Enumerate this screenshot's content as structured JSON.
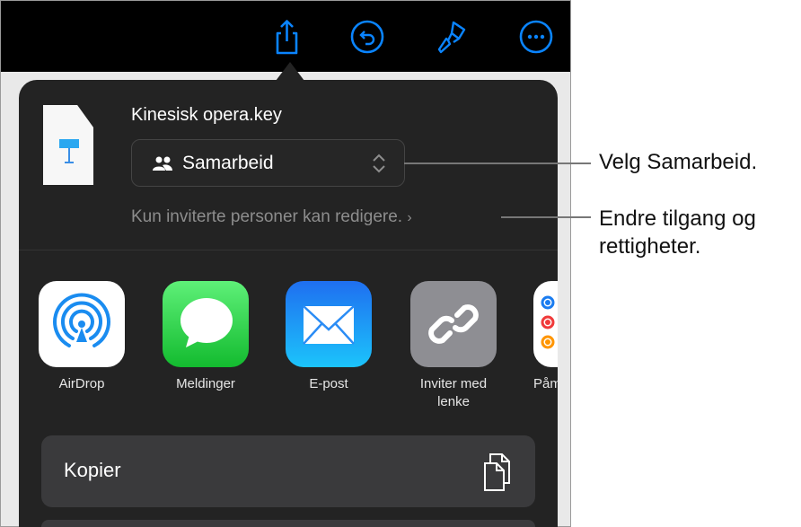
{
  "toolbar": {
    "icons": [
      "share-icon",
      "undo-icon",
      "format-brush-icon",
      "more-icon"
    ],
    "accent": "#0a84ff"
  },
  "share_sheet": {
    "file_name": "Kinesisk opera.key",
    "collab_select": {
      "value": "Samarbeid",
      "icon": "people-icon"
    },
    "access_text": "Kun inviterte personer kan redigere.",
    "apps": [
      {
        "label": "AirDrop"
      },
      {
        "label": "Meldinger"
      },
      {
        "label": "E-post"
      },
      {
        "label": "Inviter med lenke"
      },
      {
        "label": "Påm"
      }
    ],
    "copy_label": "Kopier"
  },
  "callouts": {
    "collab": "Velg Samarbeid.",
    "access": "Endre tilgang og rettigheter."
  }
}
